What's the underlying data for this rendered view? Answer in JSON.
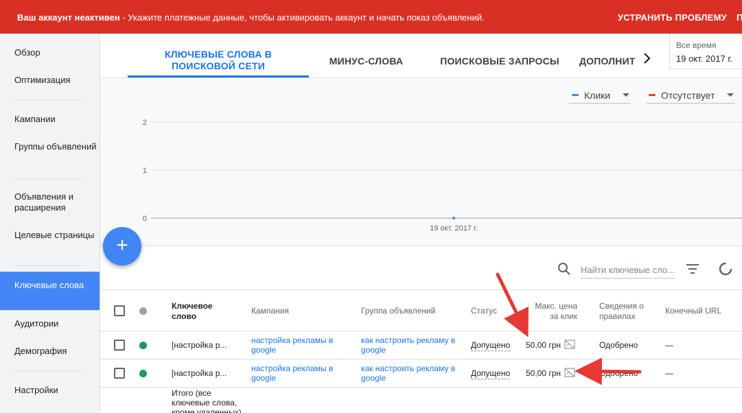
{
  "banner": {
    "title": "Ваш аккаунт неактивен",
    "message": " - Укажите платежные данные, чтобы активировать аккаунт и начать показ объявлений.",
    "fix_label": "УСТРАНИТЬ ПРОБЛЕМУ",
    "more_label": "П",
    "color": "#d93025"
  },
  "sidebar": {
    "items": [
      {
        "label": "Обзор"
      },
      {
        "label": "Оптимизация"
      },
      {
        "label": "Кампании"
      },
      {
        "label": "Группы объявлений"
      },
      {
        "label": "Объявления и расширения"
      },
      {
        "label": "Целевые страницы"
      },
      {
        "label": "Ключевые слова",
        "active": true
      },
      {
        "label": "Аудитории"
      },
      {
        "label": "Демография"
      },
      {
        "label": "Настройки"
      }
    ]
  },
  "tabs": [
    {
      "label": "КЛЮЧЕВЫЕ СЛОВА В ПОИСКОВОЙ СЕТИ",
      "active": true
    },
    {
      "label": "МИНУС-СЛОВА"
    },
    {
      "label": "ПОИСКОВЫЕ ЗАПРОСЫ"
    },
    {
      "label": "ДОПОЛНИТ"
    }
  ],
  "date_range": {
    "label": "Все время",
    "value": "19 окт. 2017 г."
  },
  "metrics": [
    {
      "label": "Клики",
      "color": "#4285f4"
    },
    {
      "label": "Отсутствует",
      "color": "#db4437"
    }
  ],
  "chart_data": {
    "type": "line",
    "y_ticks": [
      "2",
      "1",
      "0"
    ],
    "ylim": [
      0,
      2
    ],
    "x": [
      "19 окт. 2017 г."
    ],
    "series": [
      {
        "name": "Клики",
        "values": [
          0
        ],
        "color": "#4285f4"
      }
    ],
    "grid": true
  },
  "fab": {
    "label": "+"
  },
  "toolbar": {
    "search_placeholder": "Найти ключевые сло..."
  },
  "table": {
    "headers": {
      "keyword": "Ключевое слово",
      "campaign": "Кампания",
      "ad_group": "Группа объявлений",
      "status": "Статус",
      "max_cpc": "Макс. цена за клик",
      "policy": "Сведения о правилах",
      "final_url": "Конечный URL"
    },
    "rows": [
      {
        "keyword": "[настройка р...",
        "campaign": "настройка рекламы в google",
        "ad_group": "как настроить рекламу в google",
        "status": "Допущено",
        "max_cpc": "50,00 грн",
        "policy": "Одобрено",
        "final_url": "—",
        "status_color": "#0f9d58"
      },
      {
        "keyword": "[настройка р...",
        "campaign": "настройка рекламы в google",
        "ad_group": "как настроить рекламу в google",
        "status": "Допущено",
        "max_cpc": "50,00 грн",
        "policy": "Одобрено",
        "final_url": "—",
        "status_color": "#0f9d58"
      }
    ],
    "total_label": "Итого (все ключевые слова, кроме удаленных)"
  }
}
